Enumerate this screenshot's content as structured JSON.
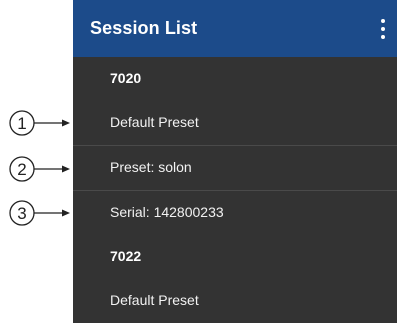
{
  "appbar": {
    "title": "Session List",
    "menu_icon": "more-vert-icon",
    "color": "#1c4b8a"
  },
  "list_background": "#333333",
  "sessions": [
    {
      "id": "7020",
      "items": [
        "Default Preset",
        "Preset: solon",
        "Serial: 142800233"
      ]
    },
    {
      "id": "7022",
      "items": [
        "Default Preset"
      ]
    }
  ],
  "callouts": [
    {
      "number": "1",
      "target": "Default Preset"
    },
    {
      "number": "2",
      "target": "Preset: solon"
    },
    {
      "number": "3",
      "target": "Serial: 142800233"
    }
  ]
}
